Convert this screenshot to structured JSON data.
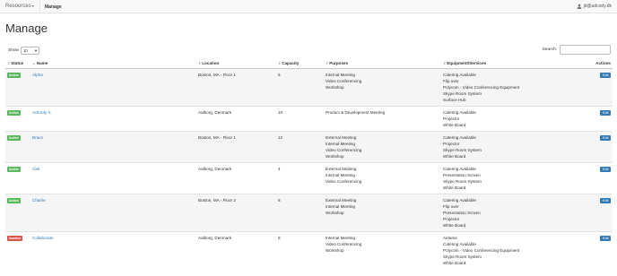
{
  "nav": {
    "brand": "Resources",
    "link": "Manage",
    "user": "jd@adcody.dk"
  },
  "page": {
    "title": "Manage"
  },
  "controls": {
    "show_label": "Show",
    "show_value": "10",
    "search_label": "Search:"
  },
  "table": {
    "headers": {
      "status": "Status",
      "name": "Name",
      "location": "Location",
      "capacity": "Capacity",
      "purposes": "Purposes",
      "equipment": "Equipment/Services",
      "actions": "Actions"
    },
    "edit_label": "Edit",
    "rows": [
      {
        "status": "Active",
        "status_type": "active",
        "name": "Alpha",
        "location": "Boston, MA - Floor 1",
        "capacity": "6",
        "purposes": [
          "Internal Meeting",
          "Video Conferencing",
          "Workshop"
        ],
        "equipment": [
          "Catering Available",
          "Flip over",
          "Polycom - Video Conferencing Equipment",
          "Skype Room System",
          "Surface Hub"
        ]
      },
      {
        "status": "Active",
        "status_type": "active",
        "name": "AdCody X",
        "location": "Aalborg, Denmark",
        "capacity": "10",
        "purposes": [
          "Product & Development Meeting"
        ],
        "equipment": [
          "Catering Available",
          "Projector",
          "White Board"
        ]
      },
      {
        "status": "Active",
        "status_type": "active",
        "name": "Bravo",
        "location": "Boston, MA - Floor 1",
        "capacity": "12",
        "purposes": [
          "External Meeting",
          "Internal Meeting",
          "Video Conferencing",
          "Workshop"
        ],
        "equipment": [
          "Catering Available",
          "Projector",
          "Skype Room System",
          "White Board"
        ]
      },
      {
        "status": "Active",
        "status_type": "active",
        "name": "Cali",
        "location": "Aalborg, Denmark",
        "capacity": "4",
        "purposes": [
          "External Meeting",
          "Internal Meeting",
          "Video Conferencing"
        ],
        "equipment": [
          "Catering Available",
          "Presentation Screen",
          "Skype Room System",
          "White Board"
        ]
      },
      {
        "status": "Active",
        "status_type": "active",
        "name": "Charlie",
        "location": "Boston, MA - Floor 2",
        "capacity": "8",
        "purposes": [
          "External Meeting",
          "Internal Meeting",
          "Workshop"
        ],
        "equipment": [
          "Catering Available",
          "Flip over",
          "Presentation Screen",
          "Projector",
          "White Board"
        ]
      },
      {
        "status": "Inactive",
        "status_type": "inactive",
        "name": "Collaborate",
        "location": "Aalborg, Denmark",
        "capacity": "8",
        "purposes": [
          "Internal Meeting",
          "Video Conferencing",
          "Workshop"
        ],
        "equipment": [
          "Airtame",
          "Catering Available",
          "Polycom - Video Conferencing Equipment",
          "Skype Room System",
          "White Board"
        ]
      }
    ]
  }
}
